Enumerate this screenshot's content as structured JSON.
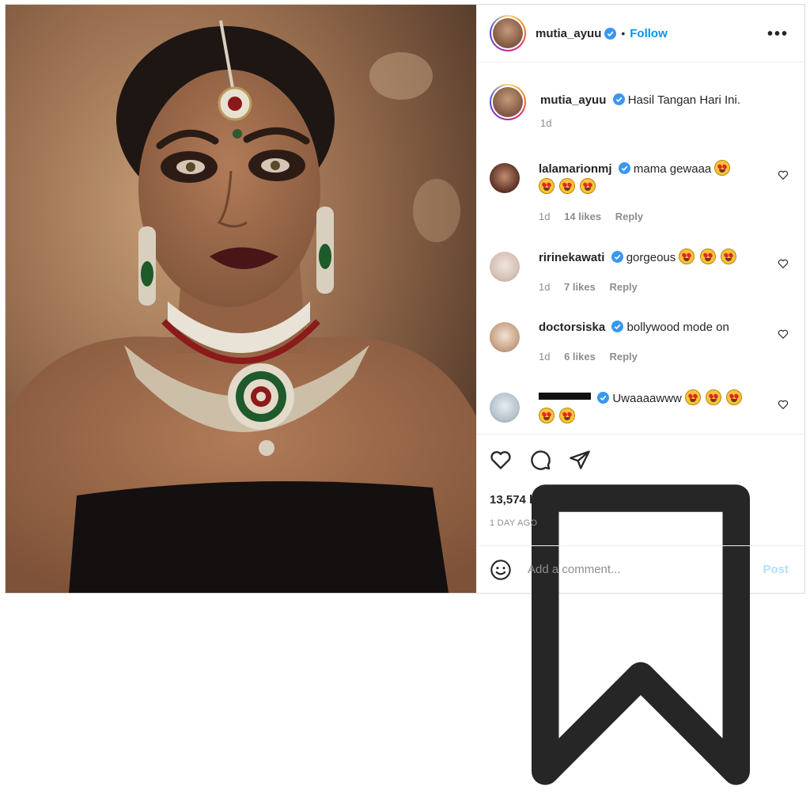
{
  "post": {
    "author": "mutia_ayuu",
    "follow_label": "Follow",
    "separator": "•",
    "more_label": "•••"
  },
  "caption": {
    "username": "mutia_ayuu",
    "text": "Hasil Tangan Hari Ini.",
    "time": "1d"
  },
  "comments": [
    {
      "username": "lalamarionmj",
      "text": "mama gewaaa",
      "time": "1d",
      "likes": "14 likes",
      "reply": "Reply"
    },
    {
      "username": "ririnekawati",
      "text": "gorgeous",
      "time": "1d",
      "likes": "7 likes",
      "reply": "Reply"
    },
    {
      "username": "doctorsiska",
      "text": "bollywood mode on",
      "time": "1d",
      "likes": "6 likes",
      "reply": "Reply"
    },
    {
      "username": "",
      "text": "Uwaaaawww"
    }
  ],
  "stats": {
    "likes": "13,574 likes",
    "ago": "1 DAY AGO"
  },
  "composer": {
    "placeholder": "Add a comment...",
    "post_label": "Post"
  },
  "icons": {
    "avatar": "profile-photo",
    "verified": "verified-badge-icon",
    "heart": "heart-icon",
    "comment": "comment-icon",
    "share": "paper-plane-icon",
    "save": "bookmark-icon",
    "emoji": "smiley-icon"
  },
  "colors": {
    "accent": "#0095f6",
    "post_disabled": "#b2dffc",
    "muted": "#8e8e8e",
    "verified": "#3897f0"
  }
}
